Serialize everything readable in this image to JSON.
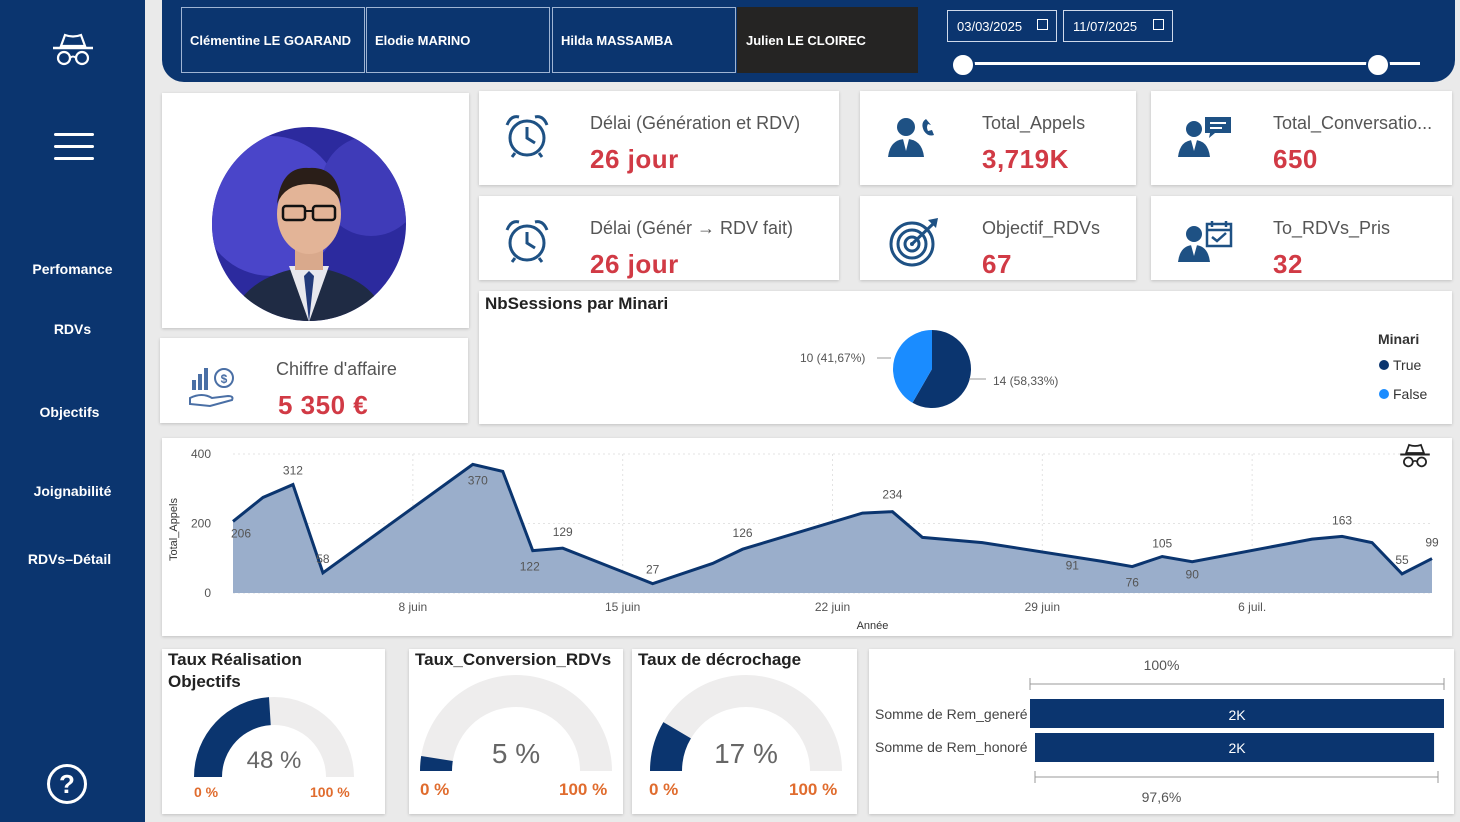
{
  "sidebar": {
    "nav": [
      {
        "label": "Perfomance",
        "active": true
      },
      {
        "label": "RDVs"
      },
      {
        "label": "Objectifs"
      },
      {
        "label": "Joignabilité"
      },
      {
        "label": "RDVs–Détail"
      }
    ],
    "help_icon": "question-circle-icon",
    "logo_icon": "incognito-icon",
    "menu_icon": "hamburger-icon"
  },
  "people": [
    {
      "name": "Clémentine LE GOARAND",
      "selected": false
    },
    {
      "name": "Elodie MARINO",
      "selected": false
    },
    {
      "name": "Hilda MASSAMBA",
      "selected": false
    },
    {
      "name": "Julien LE CLOIREC",
      "selected": true
    }
  ],
  "date_filter": {
    "start": "03/03/2025",
    "end": "11/07/2025"
  },
  "kpis": {
    "delai_generation": {
      "label": "Délai (Génération et RDV)",
      "value": "26 jour",
      "icon": "alarm-clock-icon"
    },
    "delai_fait": {
      "label": "Délai (Génér → RDV fait)",
      "value": "26 jour",
      "icon": "alarm-clock-icon"
    },
    "total_appels": {
      "label": "Total_Appels",
      "value": "3,719K",
      "icon": "person-phone-icon"
    },
    "objectif_rdvs": {
      "label": "Objectif_RDVs",
      "value": "67",
      "icon": "target-icon"
    },
    "total_conversations": {
      "label": "Total_Conversatio...",
      "value": "650",
      "icon": "person-chat-icon"
    },
    "to_rdvs_pris": {
      "label": "To_RDVs_Pris",
      "value": "32",
      "icon": "person-calendar-icon"
    },
    "chiffre_affaire": {
      "label": "Chiffre d'affaire",
      "value": "5 350 €",
      "icon": "money-growth-icon"
    }
  },
  "colors": {
    "navy": "#0b356f",
    "red": "#d13a45",
    "light_blue": "#1a8cff",
    "area_fill": "#9aaecb",
    "orange": "#e06c2e"
  },
  "pie": {
    "title": "NbSessions par Minari",
    "legend_title": "Minari",
    "label_false": "10 (41,67%)",
    "label_true": "14 (58,33%)"
  },
  "chart_data": [
    {
      "type": "pie",
      "title": "NbSessions par Minari",
      "legend_title": "Minari",
      "slices": [
        {
          "name": "True",
          "value": 14,
          "pct": 58.33,
          "color": "#0b356f"
        },
        {
          "name": "False",
          "value": 10,
          "pct": 41.67,
          "color": "#1a8cff"
        }
      ]
    },
    {
      "type": "area",
      "xlabel": "Année",
      "ylabel": "Total_Appels",
      "ylim": [
        0,
        400
      ],
      "yticks": [
        0,
        200,
        400
      ],
      "xticks": [
        {
          "label": "8 juin",
          "x": "2025-06-08"
        },
        {
          "label": "15 juin",
          "x": "2025-06-15"
        },
        {
          "label": "22 juin",
          "x": "2025-06-22"
        },
        {
          "label": "29 juin",
          "x": "2025-06-29"
        },
        {
          "label": "6 juil.",
          "x": "2025-07-06"
        }
      ],
      "grid": true,
      "points": [
        {
          "x": "2025-06-02",
          "y": 206,
          "label": "206"
        },
        {
          "x": "2025-06-03",
          "y": 275
        },
        {
          "x": "2025-06-04",
          "y": 312,
          "label": "312"
        },
        {
          "x": "2025-06-05",
          "y": 58,
          "label": "58"
        },
        {
          "x": "2025-06-10",
          "y": 370,
          "label": "370"
        },
        {
          "x": "2025-06-11",
          "y": 350
        },
        {
          "x": "2025-06-12",
          "y": 122,
          "label": "122"
        },
        {
          "x": "2025-06-13",
          "y": 129,
          "label": "129"
        },
        {
          "x": "2025-06-16",
          "y": 27,
          "label": "27"
        },
        {
          "x": "2025-06-18",
          "y": 85
        },
        {
          "x": "2025-06-19",
          "y": 126,
          "label": "126"
        },
        {
          "x": "2025-06-23",
          "y": 230
        },
        {
          "x": "2025-06-24",
          "y": 234,
          "label": "234"
        },
        {
          "x": "2025-06-25",
          "y": 160
        },
        {
          "x": "2025-06-27",
          "y": 145
        },
        {
          "x": "2025-07-01",
          "y": 91,
          "label": "91"
        },
        {
          "x": "2025-07-02",
          "y": 76,
          "label": "76"
        },
        {
          "x": "2025-07-03",
          "y": 105,
          "label": "105"
        },
        {
          "x": "2025-07-04",
          "y": 90,
          "label": "90"
        },
        {
          "x": "2025-07-08",
          "y": 155
        },
        {
          "x": "2025-07-09",
          "y": 163,
          "label": "163"
        },
        {
          "x": "2025-07-10",
          "y": 145
        },
        {
          "x": "2025-07-11",
          "y": 55,
          "label": "55"
        },
        {
          "x": "2025-07-12",
          "y": 99,
          "label": "99"
        }
      ]
    },
    {
      "type": "bar",
      "orientation": "horizontal",
      "categories": [
        "Somme de Rem_generé",
        "Somme de Rem_honoré"
      ],
      "values": [
        2000,
        1952
      ],
      "value_labels": [
        "2K",
        "2K"
      ],
      "top_label": "100%",
      "bottom_label": "97,6%"
    }
  ],
  "gauges": [
    {
      "title": "Taux Réalisation Objectifs",
      "value": 48,
      "value_label": "48 %",
      "min_label": "0 %",
      "max_label": "100 %"
    },
    {
      "title": "Taux_Conversion_RDVs",
      "value": 5,
      "value_label": "5 %",
      "min_label": "0 %",
      "max_label": "100 %"
    },
    {
      "title": "Taux de décrochage",
      "value": 17,
      "value_label": "17 %",
      "min_label": "0 %",
      "max_label": "100 %"
    }
  ],
  "rem": {
    "top_label": "100%",
    "bottom_label": "97,6%",
    "generated_label": "Somme de Rem_generé",
    "honored_label": "Somme de Rem_honoré",
    "generated_value": "2K",
    "honored_value": "2K"
  }
}
